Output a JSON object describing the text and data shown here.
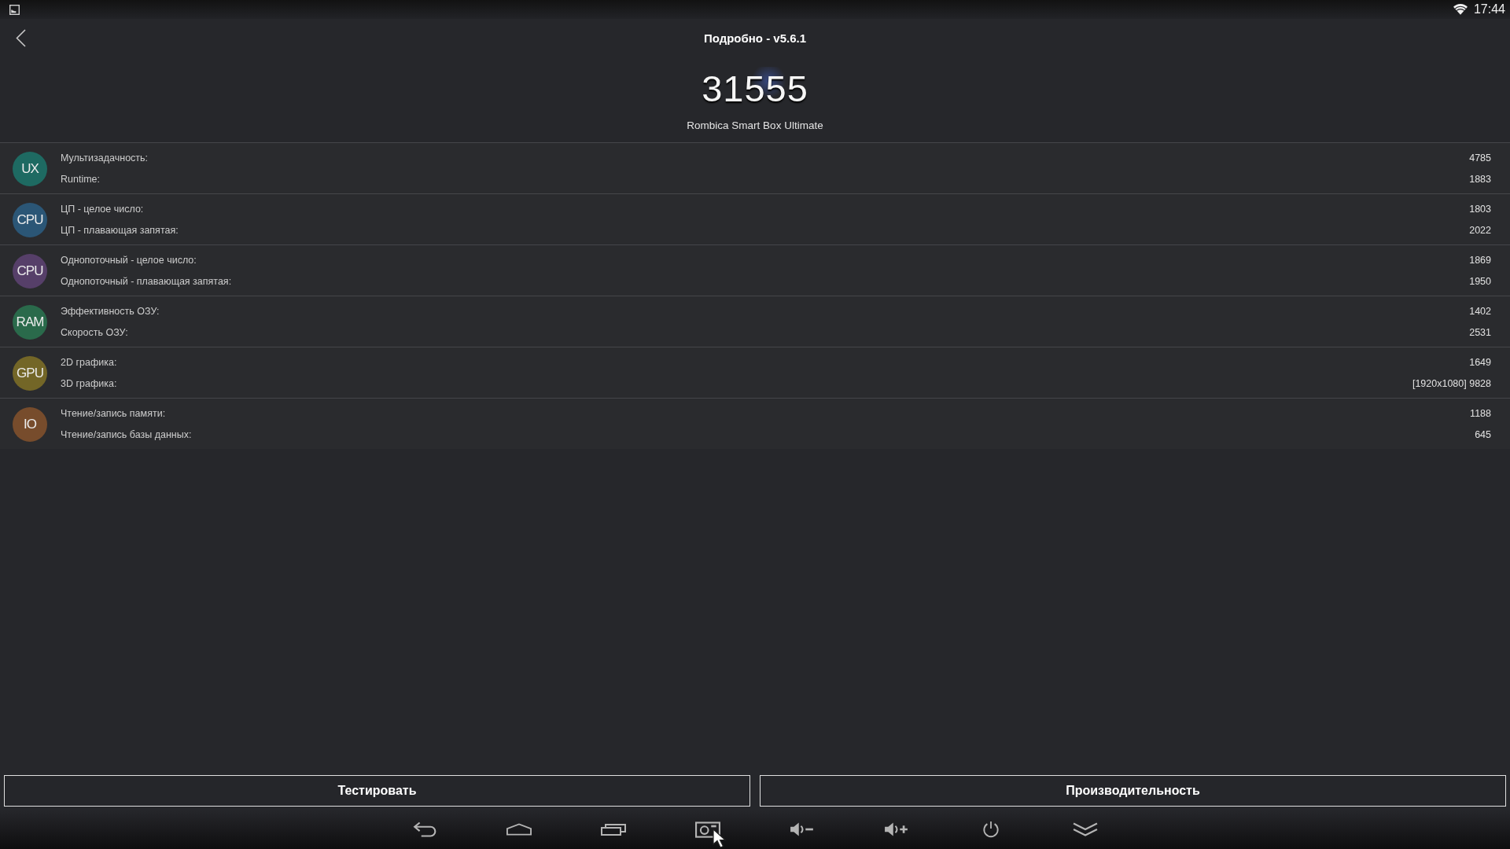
{
  "status_bar": {
    "time": "17:44"
  },
  "header": {
    "title": "Подробно - v5.6.1",
    "score": "31555",
    "device": "Rombica Smart Box Ultimate"
  },
  "categories": [
    {
      "badge": "UX",
      "color": "#1e6a62",
      "items": [
        {
          "label": "Мультизадачность:",
          "value": "4785"
        },
        {
          "label": "Runtime:",
          "value": "1883"
        }
      ]
    },
    {
      "badge": "CPU",
      "color": "#2b5676",
      "items": [
        {
          "label": "ЦП - целое число:",
          "value": "1803"
        },
        {
          "label": "ЦП - плавающая запятая:",
          "value": "2022"
        }
      ]
    },
    {
      "badge": "CPU",
      "color": "#563f69",
      "items": [
        {
          "label": "Однопоточный - целое число:",
          "value": "1869"
        },
        {
          "label": "Однопоточный - плавающая запятая:",
          "value": "1950"
        }
      ]
    },
    {
      "badge": "RAM",
      "color": "#2a6a4b",
      "items": [
        {
          "label": "Эффективность ОЗУ:",
          "value": "1402"
        },
        {
          "label": "Скорость ОЗУ:",
          "value": "2531"
        }
      ]
    },
    {
      "badge": "GPU",
      "color": "#736627",
      "items": [
        {
          "label": "2D графика:",
          "value": "1649"
        },
        {
          "label": "3D графика:",
          "value": "[1920x1080] 9828"
        }
      ]
    },
    {
      "badge": "IO",
      "color": "#774c2c",
      "items": [
        {
          "label": "Чтение/запись памяти:",
          "value": "1188"
        },
        {
          "label": "Чтение/запись базы данных:",
          "value": "645"
        }
      ]
    }
  ],
  "buttons": [
    {
      "label": "Тестировать"
    },
    {
      "label": "Производительность"
    }
  ]
}
